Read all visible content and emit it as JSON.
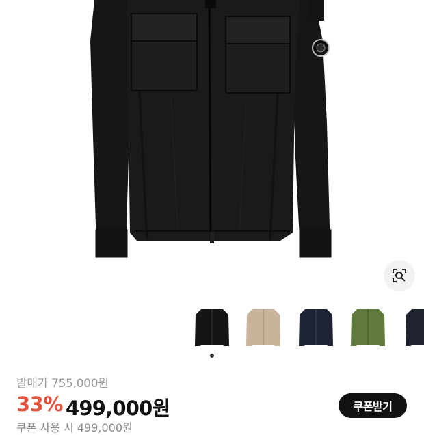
{
  "product": {
    "image_alt": "black zip-up overshirt jacket",
    "colors": {
      "jacket": "#151515",
      "discount": "#e5533f",
      "button_bg": "#111111"
    }
  },
  "icons": {
    "visual_search": "lens-search-icon"
  },
  "thumbnails": [
    {
      "name": "thumbnail-black",
      "color": "#151515",
      "selected": true
    },
    {
      "name": "thumbnail-beige",
      "color": "#c9b39b",
      "selected": false
    },
    {
      "name": "thumbnail-navy",
      "color": "#1d2333",
      "selected": false
    },
    {
      "name": "thumbnail-green",
      "color": "#5f7a3c",
      "selected": false
    },
    {
      "name": "thumbnail-dark-navy",
      "color": "#1f2330",
      "selected": false
    }
  ],
  "pricing": {
    "original_label": "발매가 755,000원",
    "discount_rate": "33%",
    "sale_price": "499,000원",
    "coupon_button": "쿠폰받기",
    "cutoff_line": "쿠폰 사용 시 499,000원"
  }
}
